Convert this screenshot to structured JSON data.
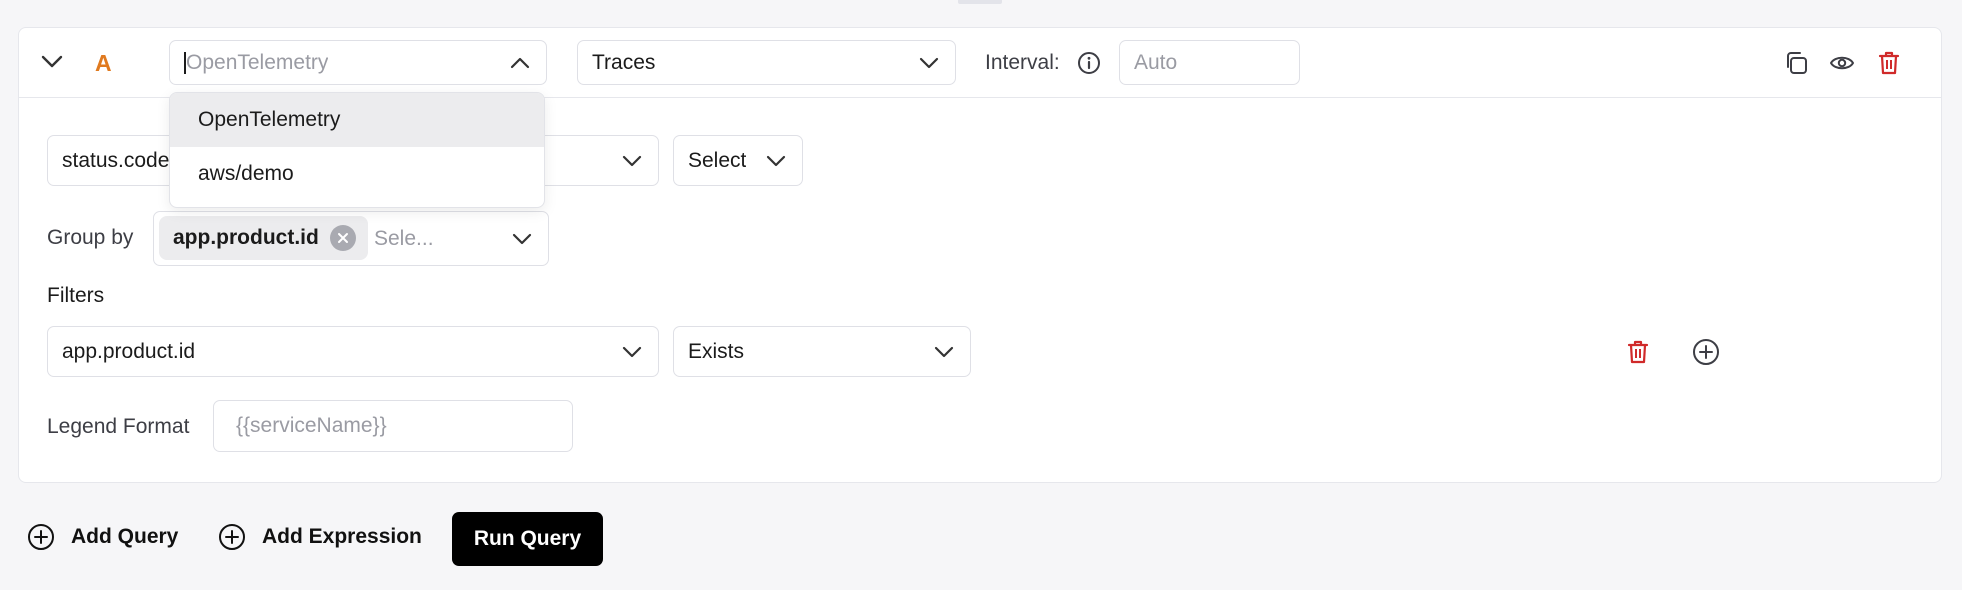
{
  "query": {
    "letter": "A",
    "data_source": {
      "placeholder": "OpenTelemetry"
    },
    "signal": {
      "value": "Traces"
    },
    "interval": {
      "label": "Interval:",
      "placeholder": "Auto"
    },
    "aggregate_attribute": {
      "value": "status.code"
    },
    "aggregate_operator": {
      "value": "Select"
    },
    "group_by": {
      "label": "Group by",
      "tags": [
        "app.product.id"
      ],
      "placeholder": "Sele..."
    },
    "filters": {
      "label": "Filters",
      "attribute": "app.product.id",
      "operator": "Exists"
    },
    "legend": {
      "label": "Legend Format",
      "placeholder": "{{serviceName}}"
    }
  },
  "dropdown": {
    "options": [
      "OpenTelemetry",
      "aws/demo"
    ],
    "highlighted_index": 0
  },
  "footer": {
    "add_query": "Add Query",
    "add_expression": "Add Expression",
    "run_query": "Run Query"
  },
  "colors": {
    "accent_letter": "#e07a1f",
    "delete_red": "#d02a2a",
    "run_button_bg": "#000000"
  }
}
